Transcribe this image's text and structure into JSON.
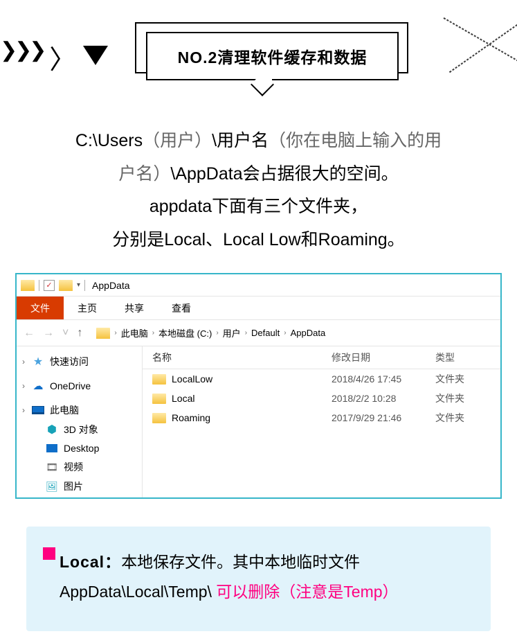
{
  "banner_title": "NO.2清理软件缓存和数据",
  "description": {
    "line1a": "C:\\Users",
    "line1b": "（用户）",
    "line1c": "\\用户名",
    "line1d": "（你在电脑上输入的用",
    "line2a": "户名）",
    "line2b": "\\AppData会占据很大的空间。",
    "line3": "appdata下面有三个文件夹，",
    "line4": "分别是Local、Local Low和Roaming。"
  },
  "explorer": {
    "title": "AppData",
    "ribbon": {
      "file": "文件",
      "home": "主页",
      "share": "共享",
      "view": "查看"
    },
    "nav": {
      "back": "←",
      "forward": "→",
      "up": "↑",
      "drop": "˅"
    },
    "breadcrumb": [
      "此电脑",
      "本地磁盘 (C:)",
      "用户",
      "Default",
      "AppData"
    ],
    "columns": {
      "name": "名称",
      "date": "修改日期",
      "type": "类型"
    },
    "rows": [
      {
        "name": "LocalLow",
        "date": "2018/4/26 17:45",
        "type": "文件夹"
      },
      {
        "name": "Local",
        "date": "2018/2/2 10:28",
        "type": "文件夹"
      },
      {
        "name": "Roaming",
        "date": "2017/9/29 21:46",
        "type": "文件夹"
      }
    ],
    "sidebar": {
      "quick": "快速访问",
      "onedrive": "OneDrive",
      "pc": "此电脑",
      "threeD": "3D 对象",
      "desktop": "Desktop",
      "video": "视频",
      "pic": "图片"
    }
  },
  "callout": {
    "lead": "Local：",
    "text1": "本地保存文件。其中本地临时文件",
    "text2": "AppData\\Local\\Temp\\ ",
    "pink": "可以删除（注意是Temp）"
  }
}
